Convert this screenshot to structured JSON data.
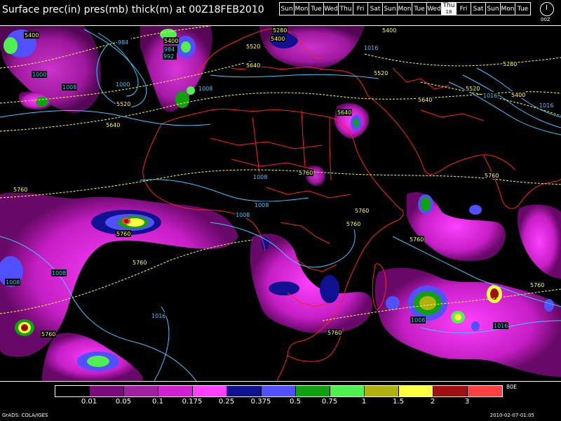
{
  "header": {
    "title": "Surface prec(in) pres(mb) thick(m) at 00Z18FEB2010"
  },
  "day_strip": {
    "days": [
      "Sun",
      "Mon",
      "Tue",
      "Wed",
      "Thu",
      "Fri",
      "Sat",
      "Sun",
      "Mon",
      "Tue",
      "Wed",
      "Thu",
      "Fri",
      "Sat",
      "Sun",
      "Mon",
      "Tue"
    ],
    "current_index": 11,
    "current_date": "18",
    "clock_label": "00Z"
  },
  "map": {
    "pressure_labels": [
      "984",
      "992",
      "1000",
      "1000",
      "1008",
      "1008",
      "1008",
      "1008",
      "1008",
      "1008",
      "1008",
      "1008",
      "1016",
      "1016",
      "1016",
      "1016",
      "1016",
      "984"
    ],
    "thickness_labels": [
      "5400",
      "5400",
      "5400",
      "5520",
      "5520",
      "5520",
      "5640",
      "5640",
      "5640",
      "5640",
      "5760",
      "5760",
      "5760",
      "5760",
      "5760",
      "5760",
      "5760",
      "5760",
      "5760",
      "5760",
      "5760",
      "5280",
      "5280",
      "5400",
      "5520",
      "5400"
    ],
    "colors": {
      "coast": "#ff2020",
      "pressure": "#3cc8ff",
      "thickness": "#ffff40"
    }
  },
  "legend": {
    "labels": [
      "0.01",
      "0.05",
      "0.1",
      "0.175",
      "0.25",
      "0.375",
      "0.5",
      "0.75",
      "1",
      "1.5",
      "2",
      "3"
    ],
    "colors": [
      "#000000",
      "#7a0a7a",
      "#a020a0",
      "#d020d0",
      "#ff40ff",
      "#101090",
      "#5050ff",
      "#10a010",
      "#50f050",
      "#b0b010",
      "#ffff40",
      "#a01010",
      "#ff4040"
    ],
    "right_label": "80E"
  },
  "footer": {
    "left": "GrADS: COLA/IGES",
    "right": "2010-02-07-01:05"
  }
}
